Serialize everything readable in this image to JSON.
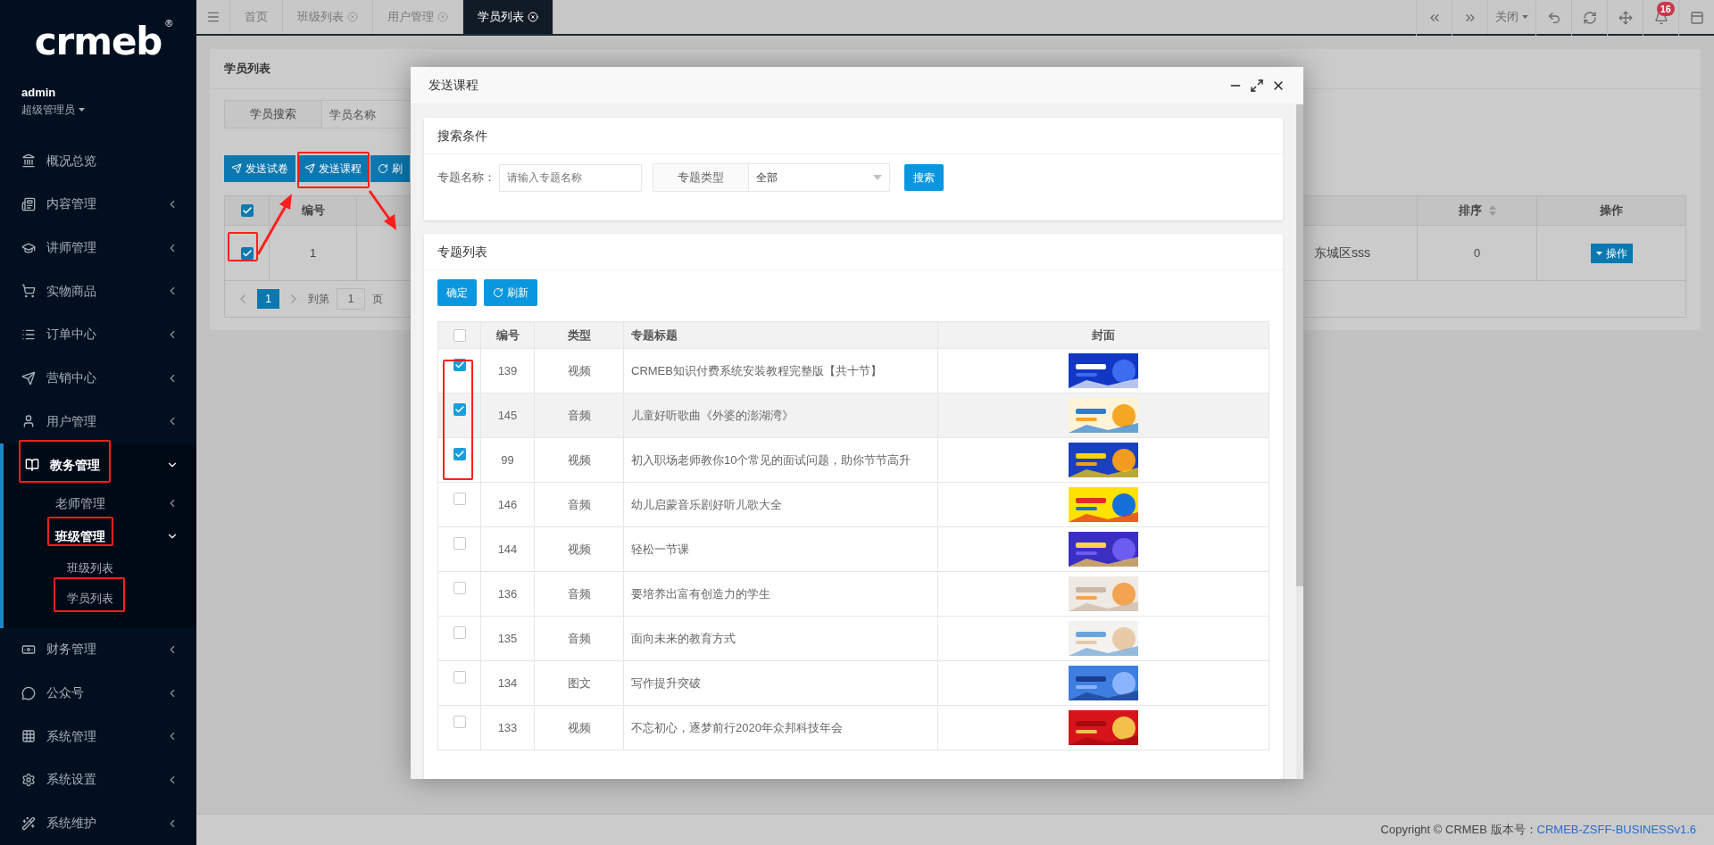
{
  "sidebar": {
    "logo": "crmeb",
    "logo_mark": "®",
    "user": {
      "name": "admin",
      "role": "超级管理员"
    },
    "items": [
      {
        "label": "概况总览",
        "kind": "link",
        "expanded": false
      },
      {
        "label": "内容管理",
        "kind": "menu",
        "expanded": false
      },
      {
        "label": "讲师管理",
        "kind": "menu",
        "expanded": false
      },
      {
        "label": "实物商品",
        "kind": "menu",
        "expanded": false
      },
      {
        "label": "订单中心",
        "kind": "menu",
        "expanded": false
      },
      {
        "label": "营销中心",
        "kind": "menu",
        "expanded": false
      },
      {
        "label": "用户管理",
        "kind": "menu",
        "expanded": false
      },
      {
        "label": "教务管理",
        "kind": "menu",
        "expanded": true,
        "children": [
          {
            "label": "老师管理",
            "kind": "menu",
            "expanded": false
          },
          {
            "label": "班级管理",
            "kind": "menu",
            "expanded": true,
            "children": [
              {
                "label": "班级列表"
              },
              {
                "label": "学员列表"
              }
            ]
          }
        ]
      },
      {
        "label": "财务管理",
        "kind": "menu",
        "expanded": false
      },
      {
        "label": "公众号",
        "kind": "menu",
        "expanded": false
      },
      {
        "label": "系统管理",
        "kind": "menu",
        "expanded": false
      },
      {
        "label": "系统设置",
        "kind": "menu",
        "expanded": false
      },
      {
        "label": "系统维护",
        "kind": "menu",
        "expanded": false
      }
    ]
  },
  "tabs": [
    {
      "label": "首页",
      "selected": false,
      "closable": false
    },
    {
      "label": "班级列表",
      "selected": false,
      "closable": true
    },
    {
      "label": "用户管理",
      "selected": false,
      "closable": true
    },
    {
      "label": "学员列表",
      "selected": true,
      "closable": true
    }
  ],
  "toolbar": {
    "close_label": "关闭",
    "notification_count": "16"
  },
  "page": {
    "title": "学员列表",
    "search": {
      "label": "学员搜索",
      "placeholder": "学员名称"
    },
    "buttons": [
      "发送试卷",
      "发送课程",
      "刷"
    ],
    "table": {
      "header_checked": true,
      "columns": [
        "编号",
        "排序",
        "操作"
      ],
      "rows": [
        {
          "checked": true,
          "id": "1",
          "address": "东城区sss",
          "sort": "0",
          "action": "操作"
        }
      ]
    },
    "pagination": {
      "current": "1",
      "goto_label": "到第",
      "goto_value": "1",
      "page_label": "页"
    }
  },
  "modal": {
    "title": "发送课程",
    "search_card": {
      "title": "搜索条件",
      "name_label": "专题名称：",
      "name_placeholder": "请输入专题名称",
      "type_label": "专题类型",
      "type_value": "全部",
      "search_button": "搜索"
    },
    "list_card": {
      "title": "专题列表",
      "confirm_button": "确定",
      "refresh_button": "刷新",
      "table": {
        "header_checked": false,
        "columns": [
          "编号",
          "类型",
          "专题标题",
          "封面"
        ],
        "rows": [
          {
            "checked": true,
            "hovered": false,
            "id": "139",
            "type": "视频",
            "title": "CRMEB知识付费系统安装教程完整版【共十节】"
          },
          {
            "checked": true,
            "hovered": true,
            "id": "145",
            "type": "音频",
            "title": "儿童好听歌曲《外婆的澎湖湾》"
          },
          {
            "checked": true,
            "hovered": false,
            "id": "99",
            "type": "视频",
            "title": "初入职场老师教你10个常见的面试问题，助你节节高升"
          },
          {
            "checked": false,
            "hovered": false,
            "id": "146",
            "type": "音频",
            "title": "幼儿启蒙音乐剧好听儿歌大全"
          },
          {
            "checked": false,
            "hovered": false,
            "id": "144",
            "type": "视频",
            "title": "轻松一节课"
          },
          {
            "checked": false,
            "hovered": false,
            "id": "136",
            "type": "音频",
            "title": "要培养出富有创造力的学生"
          },
          {
            "checked": false,
            "hovered": false,
            "id": "135",
            "type": "音频",
            "title": "面向未来的教育方式"
          },
          {
            "checked": false,
            "hovered": false,
            "id": "134",
            "type": "图文",
            "title": "写作提升突破"
          },
          {
            "checked": false,
            "hovered": false,
            "id": "133",
            "type": "视频",
            "title": "不忘初心，逐梦前行2020年众邦科技年会"
          }
        ]
      }
    }
  },
  "footer": {
    "copyright": "Copyright © CRMEB 版本号：",
    "version": "CRMEB-ZSFF-BUSINESSv1.6"
  }
}
